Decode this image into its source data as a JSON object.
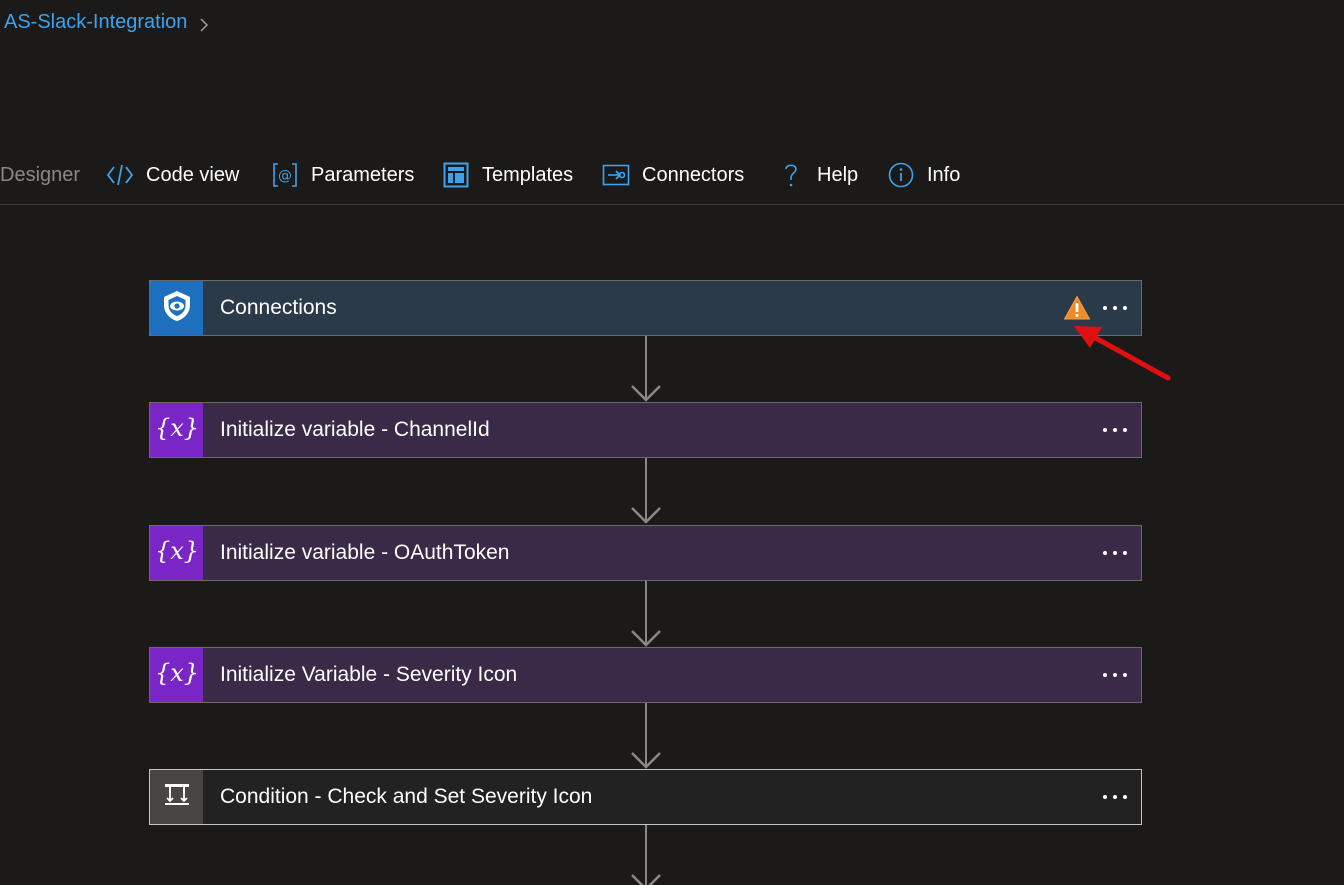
{
  "breadcrumb": {
    "workflow_name": "AS-Slack-Integration"
  },
  "toolbar": {
    "designer": "Designer",
    "code_view": "Code view",
    "parameters": "Parameters",
    "templates": "Templates",
    "connectors": "Connectors",
    "help": "Help",
    "info": "Info"
  },
  "steps": [
    {
      "title": "Connections",
      "icon": "shield-icon",
      "has_warning": true,
      "color": "#2b3a48",
      "icon_bg": "#1f6fbf"
    },
    {
      "title": "Initialize variable - ChannelId",
      "icon": "variable-icon",
      "has_warning": false,
      "color": "#3a2a48",
      "icon_bg": "#7a25c5"
    },
    {
      "title": "Initialize variable - OAuthToken",
      "icon": "variable-icon",
      "has_warning": false,
      "color": "#3a2a48",
      "icon_bg": "#7a25c5"
    },
    {
      "title": "Initialize Variable - Severity Icon",
      "icon": "variable-icon",
      "has_warning": false,
      "color": "#3a2a48",
      "icon_bg": "#7a25c5"
    },
    {
      "title": "Condition - Check and Set Severity Icon",
      "icon": "condition-icon",
      "has_warning": false,
      "color": "#222222",
      "icon_bg": "#484644"
    }
  ],
  "colors": {
    "accent": "#3ea2ee",
    "warning": "#f08a24",
    "annotation_arrow": "#e01010"
  }
}
